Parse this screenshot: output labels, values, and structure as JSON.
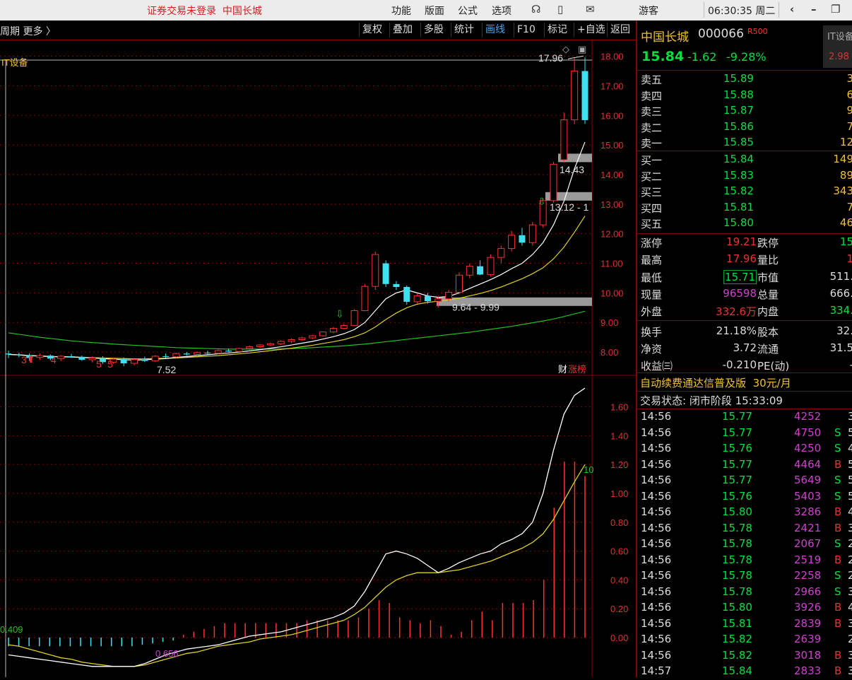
{
  "titlebar": {
    "warning": "证券交易未登录",
    "stock": "中国长城",
    "menus": [
      "功能",
      "版面",
      "公式",
      "选项"
    ],
    "user": "游客",
    "clock": "06:30:35 周二"
  },
  "tabbar": {
    "left_text": "周期  更多 〉",
    "buttons": [
      "复权",
      "叠加",
      "多股",
      "统计",
      "画线",
      "F10",
      "标记",
      "+自选",
      "返回"
    ],
    "active": "画线"
  },
  "chart_data": [
    {
      "type": "candlestick",
      "indicator_label": "IT设备",
      "side_label_1": "财",
      "side_label_2": "涨榜",
      "ylim": [
        7.5,
        18.3
      ],
      "yticks": [
        "18.00",
        "17.00",
        "16.00",
        "15.00",
        "14.00",
        "13.00",
        "12.00",
        "11.00",
        "10.00",
        "9.00",
        "8.00"
      ],
      "annotations": [
        "17.96",
        "14.43",
        "13.12 - 1",
        "9.64 - 9.99",
        "7.52"
      ],
      "markers": [
        "3",
        "4",
        "5",
        "5"
      ],
      "candles": [
        [
          7.95,
          8.05,
          7.8,
          7.92
        ],
        [
          7.92,
          7.98,
          7.82,
          7.9
        ],
        [
          7.9,
          7.96,
          7.7,
          7.8
        ],
        [
          7.82,
          7.95,
          7.75,
          7.88
        ],
        [
          7.88,
          7.92,
          7.72,
          7.78
        ],
        [
          7.78,
          7.9,
          7.7,
          7.86
        ],
        [
          7.86,
          7.94,
          7.8,
          7.84
        ],
        [
          7.84,
          7.88,
          7.7,
          7.74
        ],
        [
          7.74,
          7.85,
          7.65,
          7.8
        ],
        [
          7.8,
          7.86,
          7.6,
          7.66
        ],
        [
          7.66,
          7.8,
          7.6,
          7.76
        ],
        [
          7.76,
          7.82,
          7.52,
          7.62
        ],
        [
          7.62,
          7.8,
          7.55,
          7.75
        ],
        [
          7.75,
          7.85,
          7.66,
          7.7
        ],
        [
          7.7,
          7.9,
          7.66,
          7.86
        ],
        [
          7.86,
          7.95,
          7.8,
          7.84
        ],
        [
          7.84,
          7.98,
          7.8,
          7.95
        ],
        [
          7.95,
          8.0,
          7.88,
          7.92
        ],
        [
          7.92,
          8.02,
          7.86,
          7.98
        ],
        [
          7.98,
          8.05,
          7.92,
          7.96
        ],
        [
          7.96,
          8.08,
          7.92,
          8.05
        ],
        [
          8.05,
          8.12,
          8.0,
          8.02
        ],
        [
          8.02,
          8.15,
          8.0,
          8.12
        ],
        [
          8.12,
          8.22,
          8.08,
          8.18
        ],
        [
          8.18,
          8.26,
          8.14,
          8.24
        ],
        [
          8.24,
          8.32,
          8.2,
          8.28
        ],
        [
          8.28,
          8.4,
          8.24,
          8.36
        ],
        [
          8.36,
          8.46,
          8.3,
          8.42
        ],
        [
          8.42,
          8.52,
          8.38,
          8.48
        ],
        [
          8.48,
          8.58,
          8.44,
          8.55
        ],
        [
          8.55,
          8.7,
          8.52,
          8.68
        ],
        [
          8.68,
          8.85,
          8.64,
          8.8
        ],
        [
          8.8,
          8.95,
          8.76,
          8.9
        ],
        [
          8.9,
          9.45,
          8.88,
          9.4
        ],
        [
          9.4,
          10.3,
          9.38,
          10.22
        ],
        [
          10.22,
          11.4,
          10.1,
          11.3
        ],
        [
          11.0,
          11.1,
          10.2,
          10.3
        ],
        [
          10.3,
          10.4,
          10.1,
          10.2
        ],
        [
          10.2,
          10.25,
          9.6,
          9.7
        ],
        [
          9.7,
          9.99,
          9.64,
          9.9
        ],
        [
          9.9,
          10.0,
          9.64,
          9.72
        ],
        [
          9.72,
          9.9,
          9.5,
          9.8
        ],
        [
          9.8,
          10.1,
          9.7,
          10.02
        ],
        [
          10.02,
          10.7,
          9.95,
          10.6
        ],
        [
          10.6,
          11.0,
          10.5,
          10.9
        ],
        [
          10.9,
          11.1,
          10.6,
          10.62
        ],
        [
          10.62,
          11.3,
          10.55,
          11.2
        ],
        [
          11.2,
          11.6,
          11.0,
          11.5
        ],
        [
          11.5,
          12.1,
          11.4,
          11.95
        ],
        [
          11.95,
          12.2,
          11.6,
          11.7
        ],
        [
          11.7,
          12.4,
          11.6,
          12.3
        ],
        [
          12.3,
          13.2,
          12.2,
          13.12
        ],
        [
          13.12,
          14.43,
          13.05,
          14.35
        ],
        [
          14.5,
          16.1,
          14.4,
          15.85
        ],
        [
          15.85,
          17.96,
          15.7,
          17.5
        ],
        [
          17.5,
          17.96,
          15.71,
          15.84
        ]
      ],
      "ma_short": [
        7.92,
        7.91,
        7.88,
        7.87,
        7.85,
        7.84,
        7.84,
        7.82,
        7.8,
        7.78,
        7.76,
        7.74,
        7.73,
        7.74,
        7.76,
        7.78,
        7.82,
        7.85,
        7.88,
        7.91,
        7.94,
        7.97,
        8.0,
        8.04,
        8.08,
        8.13,
        8.18,
        8.24,
        8.3,
        8.36,
        8.44,
        8.52,
        8.62,
        8.76,
        9.0,
        9.4,
        9.8,
        10.0,
        10.1,
        10.0,
        9.9,
        9.85,
        9.88,
        10.0,
        10.15,
        10.3,
        10.45,
        10.62,
        10.82,
        11.0,
        11.3,
        11.7,
        12.3,
        13.1,
        14.2,
        15.1
      ],
      "ma_long": [
        7.92,
        7.9,
        7.88,
        7.86,
        7.85,
        7.84,
        7.83,
        7.82,
        7.81,
        7.8,
        7.79,
        7.78,
        7.77,
        7.77,
        7.78,
        7.79,
        7.8,
        7.82,
        7.84,
        7.86,
        7.88,
        7.91,
        7.94,
        7.97,
        8.01,
        8.05,
        8.09,
        8.13,
        8.18,
        8.23,
        8.29,
        8.35,
        8.42,
        8.52,
        8.65,
        8.85,
        9.1,
        9.32,
        9.5,
        9.62,
        9.68,
        9.72,
        9.76,
        9.82,
        9.9,
        9.98,
        10.08,
        10.2,
        10.34,
        10.48,
        10.65,
        10.85,
        11.15,
        11.55,
        12.05,
        12.6
      ],
      "ma_green": [
        8.65,
        8.6,
        8.55,
        8.5,
        8.46,
        8.42,
        8.38,
        8.35,
        8.32,
        8.3,
        8.27,
        8.25,
        8.23,
        8.21,
        8.19,
        8.17,
        8.15,
        8.14,
        8.13,
        8.12,
        8.11,
        8.1,
        8.1,
        8.1,
        8.1,
        8.1,
        8.11,
        8.12,
        8.13,
        8.15,
        8.17,
        8.19,
        8.21,
        8.24,
        8.27,
        8.31,
        8.35,
        8.39,
        8.43,
        8.47,
        8.51,
        8.55,
        8.59,
        8.63,
        8.67,
        8.72,
        8.77,
        8.82,
        8.87,
        8.93,
        8.99,
        9.05,
        9.12,
        9.2,
        9.29,
        9.38
      ]
    },
    {
      "type": "bar",
      "ylim": [
        -0.25,
        1.75
      ],
      "yticks": [
        "1.60",
        "1.40",
        "1.20",
        "1.00",
        "0.80",
        "0.60",
        "0.40",
        "0.20",
        "0.00"
      ],
      "labels": [
        "0.409",
        "0.656",
        "10"
      ],
      "values": [
        -0.06,
        -0.06,
        -0.06,
        -0.06,
        -0.06,
        -0.06,
        -0.06,
        -0.06,
        -0.06,
        -0.06,
        -0.06,
        -0.06,
        -0.06,
        -0.05,
        -0.04,
        -0.03,
        -0.02,
        0.02,
        0.04,
        0.06,
        0.08,
        0.1,
        0.1,
        0.1,
        0.1,
        0.1,
        0.1,
        0.1,
        0.1,
        0.12,
        0.12,
        0.12,
        0.12,
        0.12,
        0.14,
        0.2,
        0.26,
        0.24,
        0.14,
        0.12,
        0.1,
        0.12,
        0.08,
        0.02,
        0.04,
        0.12,
        0.18,
        0.12,
        0.24,
        0.24,
        0.24,
        0.26,
        0.4,
        0.9,
        1.22,
        1.22,
        1.12
      ],
      "white_line": [
        -0.12,
        -0.13,
        -0.14,
        -0.15,
        -0.16,
        -0.17,
        -0.18,
        -0.19,
        -0.2,
        -0.2,
        -0.2,
        -0.2,
        -0.2,
        -0.18,
        -0.15,
        -0.12,
        -0.1,
        -0.08,
        -0.07,
        -0.06,
        -0.05,
        -0.03,
        -0.01,
        0.01,
        0.02,
        0.03,
        0.04,
        0.06,
        0.08,
        0.1,
        0.12,
        0.14,
        0.17,
        0.22,
        0.32,
        0.45,
        0.58,
        0.6,
        0.58,
        0.55,
        0.5,
        0.45,
        0.48,
        0.52,
        0.55,
        0.58,
        0.6,
        0.65,
        0.68,
        0.72,
        0.8,
        1.0,
        1.3,
        1.55,
        1.68,
        1.73
      ],
      "yellow_line": [
        -0.05,
        -0.06,
        -0.08,
        -0.1,
        -0.12,
        -0.14,
        -0.15,
        -0.17,
        -0.18,
        -0.19,
        -0.2,
        -0.2,
        -0.2,
        -0.19,
        -0.17,
        -0.15,
        -0.13,
        -0.11,
        -0.1,
        -0.08,
        -0.06,
        -0.05,
        -0.04,
        -0.03,
        -0.01,
        0.0,
        0.01,
        0.02,
        0.04,
        0.06,
        0.08,
        0.1,
        0.12,
        0.16,
        0.21,
        0.28,
        0.35,
        0.4,
        0.43,
        0.45,
        0.45,
        0.45,
        0.46,
        0.47,
        0.49,
        0.51,
        0.53,
        0.56,
        0.59,
        0.62,
        0.66,
        0.72,
        0.82,
        0.95,
        1.08,
        1.2
      ]
    }
  ],
  "quote": {
    "name": "中国长城",
    "code": "000066",
    "badge": "R500",
    "tag": "IT设备",
    "tag_pct": "2.98",
    "price": "15.84",
    "change": "-1.62",
    "change_pct": "-9.28%",
    "asks": [
      {
        "label": "卖五",
        "price": "15.89",
        "vol": "3"
      },
      {
        "label": "卖四",
        "price": "15.88",
        "vol": "6"
      },
      {
        "label": "卖三",
        "price": "15.87",
        "vol": "9"
      },
      {
        "label": "卖二",
        "price": "15.86",
        "vol": "7"
      },
      {
        "label": "卖一",
        "price": "15.85",
        "vol": "12"
      }
    ],
    "bids": [
      {
        "label": "买一",
        "price": "15.84",
        "vol": "149"
      },
      {
        "label": "买二",
        "price": "15.83",
        "vol": "89"
      },
      {
        "label": "买三",
        "price": "15.82",
        "vol": "343"
      },
      {
        "label": "买四",
        "price": "15.81",
        "vol": "7"
      },
      {
        "label": "买五",
        "price": "15.80",
        "vol": "46"
      }
    ],
    "stats": [
      {
        "l1": "涨停",
        "v1": "19.21",
        "c1": "red",
        "l2": "跌停",
        "v2": "15",
        "c2": "grn"
      },
      {
        "l1": "最高",
        "v1": "17.96",
        "c1": "red",
        "l2": "量比",
        "v2": "1",
        "c2": "red"
      },
      {
        "l1": "最低",
        "v1": "15.71",
        "c1": "grn",
        "l2": "市值",
        "v2": "511.",
        "c2": "lbl-w"
      },
      {
        "l1": "现量",
        "v1": "96598",
        "c1": "mag",
        "l2": "总量",
        "v2": "666.",
        "c2": "lbl-w"
      },
      {
        "l1": "外盘",
        "v1": "332.6万",
        "c1": "red",
        "l2": "内盘",
        "v2": "334.",
        "c2": "grn"
      },
      {
        "l1": "换手",
        "v1": "21.18%",
        "c1": "lbl-w",
        "l2": "股本",
        "v2": "32.",
        "c2": "lbl-w"
      },
      {
        "l1": "净资",
        "v1": "3.72",
        "c1": "lbl-w",
        "l2": "流通",
        "v2": "31.5",
        "c2": "lbl-w"
      },
      {
        "l1": "收益㈢",
        "v1": "-0.210",
        "c1": "lbl-w",
        "l2": "PE(动)",
        "v2": "-",
        "c2": "lbl-w"
      }
    ],
    "promo": "自动续费通达信普及版",
    "promo_price": "30元/月",
    "trade_status": "交易状态: 闭市阶段 15:33:09",
    "ticks": [
      {
        "t": "14:56",
        "p": "15.77",
        "v": "4252",
        "d": "",
        "r": "3"
      },
      {
        "t": "14:56",
        "p": "15.77",
        "v": "4750",
        "d": "S",
        "r": "5"
      },
      {
        "t": "14:56",
        "p": "15.76",
        "v": "4250",
        "d": "S",
        "r": "4"
      },
      {
        "t": "14:56",
        "p": "15.77",
        "v": "4464",
        "d": "B",
        "r": "5"
      },
      {
        "t": "14:56",
        "p": "15.77",
        "v": "5649",
        "d": "S",
        "r": "5"
      },
      {
        "t": "14:56",
        "p": "15.76",
        "v": "5403",
        "d": "S",
        "r": "5"
      },
      {
        "t": "14:56",
        "p": "15.80",
        "v": "3286",
        "d": "B",
        "r": "4"
      },
      {
        "t": "14:56",
        "p": "15.78",
        "v": "2421",
        "d": "B",
        "r": "3"
      },
      {
        "t": "14:56",
        "p": "15.78",
        "v": "2067",
        "d": "S",
        "r": "2"
      },
      {
        "t": "14:56",
        "p": "15.78",
        "v": "2519",
        "d": "B",
        "r": "2"
      },
      {
        "t": "14:56",
        "p": "15.78",
        "v": "2258",
        "d": "S",
        "r": "2"
      },
      {
        "t": "14:56",
        "p": "15.78",
        "v": "2966",
        "d": "S",
        "r": "3"
      },
      {
        "t": "14:56",
        "p": "15.80",
        "v": "3926",
        "d": "B",
        "r": "4"
      },
      {
        "t": "14:56",
        "p": "15.81",
        "v": "2839",
        "d": "B",
        "r": "3"
      },
      {
        "t": "14:56",
        "p": "15.82",
        "v": "2639",
        "d": "",
        "r": "2"
      },
      {
        "t": "14:56",
        "p": "15.82",
        "v": "3018",
        "d": "B",
        "r": "3"
      },
      {
        "t": "14:57",
        "p": "15.84",
        "v": "2833",
        "d": "B",
        "r": "3"
      }
    ]
  }
}
